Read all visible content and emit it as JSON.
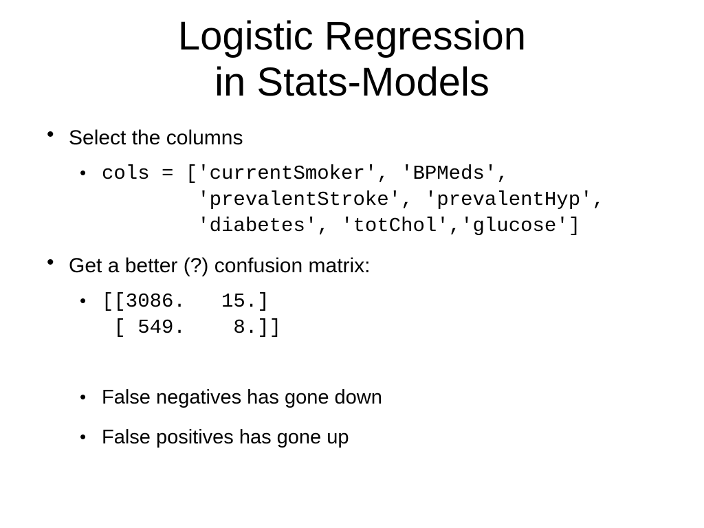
{
  "title_line1": "Logistic Regression",
  "title_line2": "in Stats-Models",
  "bullets": {
    "b1": {
      "text": "Select the columns",
      "code": "cols = ['currentSmoker', 'BPMeds',\n        'prevalentStroke', 'prevalentHyp',\n        'diabetes', 'totChol','glucose']"
    },
    "b2": {
      "text": "Get a better (?) confusion matrix:",
      "code": "[[3086.   15.]\n [ 549.    8.]]",
      "sub1": "False negatives has gone down",
      "sub2": "False positives has gone up"
    }
  }
}
